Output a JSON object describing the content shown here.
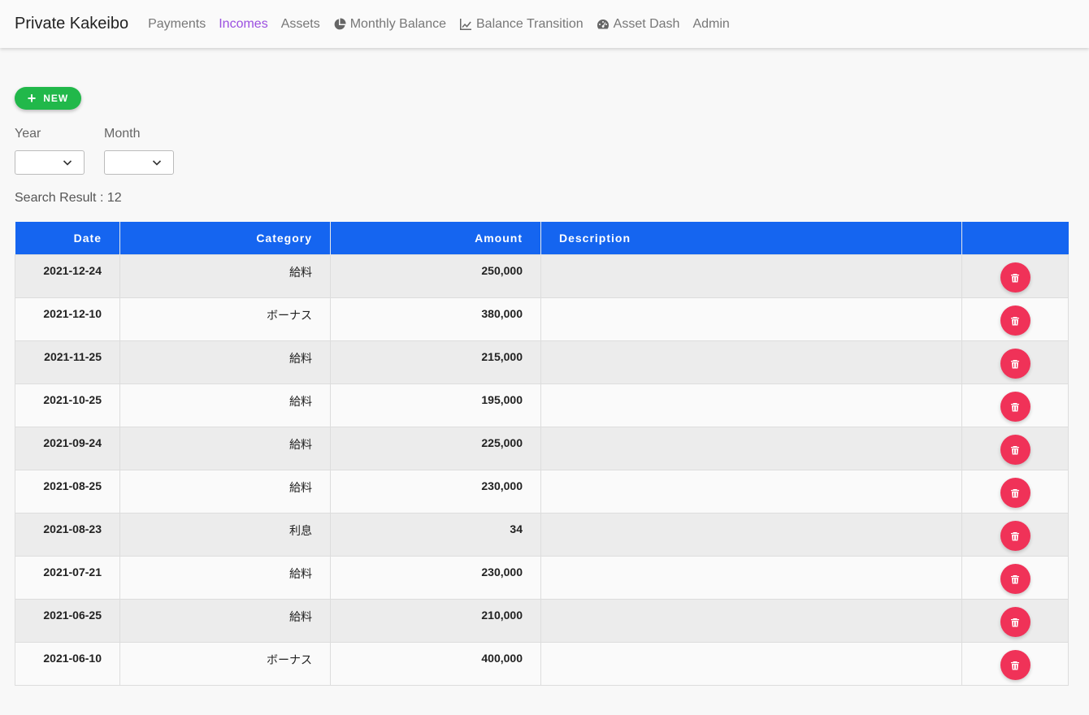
{
  "nav": {
    "brand": "Private Kakeibo",
    "items": [
      {
        "label": "Payments",
        "icon": "",
        "active": false
      },
      {
        "label": "Incomes",
        "icon": "",
        "active": true
      },
      {
        "label": "Assets",
        "icon": "",
        "active": false
      },
      {
        "label": "Monthly Balance",
        "icon": "pie-chart-icon",
        "active": false
      },
      {
        "label": "Balance Transition",
        "icon": "line-chart-icon",
        "active": false
      },
      {
        "label": "Asset Dash",
        "icon": "dashboard-icon",
        "active": false
      },
      {
        "label": "Admin",
        "icon": "",
        "active": false
      }
    ]
  },
  "actions": {
    "new_label": "NEW"
  },
  "filters": {
    "year_label": "Year",
    "month_label": "Month",
    "year_value": "",
    "month_value": ""
  },
  "search_result": "Search Result : 12",
  "table": {
    "headers": [
      "Date",
      "Category",
      "Amount",
      "Description",
      ""
    ],
    "rows": [
      {
        "date": "2021-12-24",
        "category": "給料",
        "amount": "250,000",
        "description": ""
      },
      {
        "date": "2021-12-10",
        "category": "ボーナス",
        "amount": "380,000",
        "description": ""
      },
      {
        "date": "2021-11-25",
        "category": "給料",
        "amount": "215,000",
        "description": ""
      },
      {
        "date": "2021-10-25",
        "category": "給料",
        "amount": "195,000",
        "description": ""
      },
      {
        "date": "2021-09-24",
        "category": "給料",
        "amount": "225,000",
        "description": ""
      },
      {
        "date": "2021-08-25",
        "category": "給料",
        "amount": "230,000",
        "description": ""
      },
      {
        "date": "2021-08-23",
        "category": "利息",
        "amount": "34",
        "description": ""
      },
      {
        "date": "2021-07-21",
        "category": "給料",
        "amount": "230,000",
        "description": ""
      },
      {
        "date": "2021-06-25",
        "category": "給料",
        "amount": "210,000",
        "description": ""
      },
      {
        "date": "2021-06-10",
        "category": "ボーナス",
        "amount": "400,000",
        "description": ""
      }
    ]
  },
  "colors": {
    "header_bg": "#1565f0",
    "new_button": "#21b84a",
    "delete_button": "#f03258",
    "active_nav": "#9b4fe0"
  }
}
